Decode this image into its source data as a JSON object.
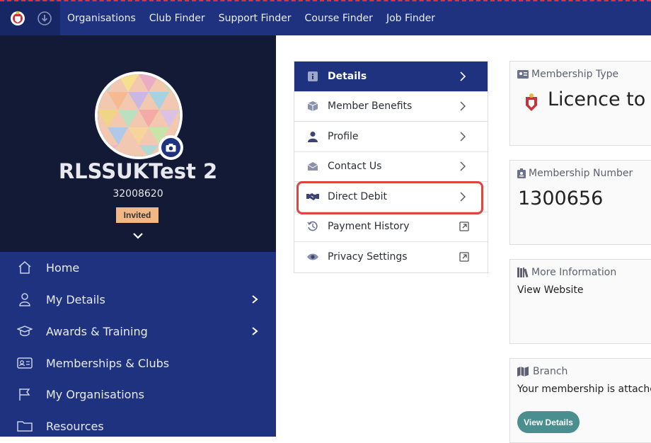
{
  "topnav": {
    "items": [
      "Organisations",
      "Club Finder",
      "Support Finder",
      "Course Finder",
      "Job Finder"
    ]
  },
  "profile": {
    "name": "RLSSUKTest 2",
    "number": "32008620",
    "status": "Invited"
  },
  "sidebar": {
    "items": [
      {
        "label": "Home",
        "icon": "home-icon"
      },
      {
        "label": "My Details",
        "icon": "user-icon"
      },
      {
        "label": "Awards & Training",
        "icon": "graduation-cap-icon"
      },
      {
        "label": "Memberships & Clubs",
        "icon": "id-card-icon"
      },
      {
        "label": "My Organisations",
        "icon": "flag-icon"
      },
      {
        "label": "Resources",
        "icon": "folder-icon"
      }
    ]
  },
  "menu_card": {
    "items": [
      {
        "label": "Details",
        "icon": "info-icon",
        "arrow": "chevron"
      },
      {
        "label": "Member Benefits",
        "icon": "box-icon",
        "arrow": "chevron"
      },
      {
        "label": "Profile",
        "icon": "user-icon",
        "arrow": "chevron"
      },
      {
        "label": "Contact Us",
        "icon": "envelope-icon",
        "arrow": "chevron"
      },
      {
        "label": "Direct Debit",
        "icon": "handshake-icon",
        "arrow": "chevron"
      },
      {
        "label": "Payment History",
        "icon": "history-icon",
        "arrow": "external"
      },
      {
        "label": "Privacy Settings",
        "icon": "eye-icon",
        "arrow": "external"
      }
    ]
  },
  "panels": {
    "membership_type": {
      "label": "Membership Type",
      "value": "Licence to C"
    },
    "membership_number": {
      "label": "Membership Number",
      "value": "1300656"
    },
    "more_info": {
      "label": "More Information",
      "link": "View Website"
    },
    "branch": {
      "label": "Branch",
      "text": "Your membership is attached t",
      "button": "View Details"
    }
  },
  "colors": {
    "navy": "#1f3280",
    "dark": "#121a35",
    "highlight": "#e0443d",
    "badge": "#f1b886",
    "teal": "#4a8f8f"
  }
}
